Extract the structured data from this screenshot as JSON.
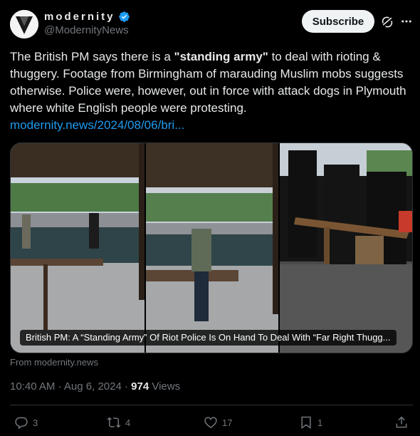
{
  "author": {
    "display_name": "modernity",
    "handle": "@ModernityNews",
    "verified": true
  },
  "header": {
    "subscribe_label": "Subscribe"
  },
  "tweet": {
    "text_part1": "The British PM says there is a ",
    "text_bold": "\"standing army\"",
    "text_part2": " to deal with rioting & thuggery. Footage from Birmingham of marauding Muslim mobs suggests otherwise. Police were, however, out in force with attack dogs in Plymouth where white English people were protesting.",
    "link": "modernity.news/2024/08/06/bri..."
  },
  "media": {
    "caption": "British PM: A “Standing Army” Of Riot Police Is On Hand To Deal With “Far Right Thugg...",
    "source": "From modernity.news"
  },
  "meta": {
    "time": "10:40 AM",
    "separator": " · ",
    "date": "Aug 6, 2024",
    "separator2": " · ",
    "views_count": "974",
    "views_label": " Views"
  },
  "actions": {
    "replies": "3",
    "reposts": "4",
    "likes": "17",
    "bookmarks": "1"
  },
  "colors": {
    "background": "#000000",
    "text": "#e7e9ea",
    "secondary": "#71767b",
    "link": "#1d9bf0",
    "verified": "#1d9bf0"
  }
}
